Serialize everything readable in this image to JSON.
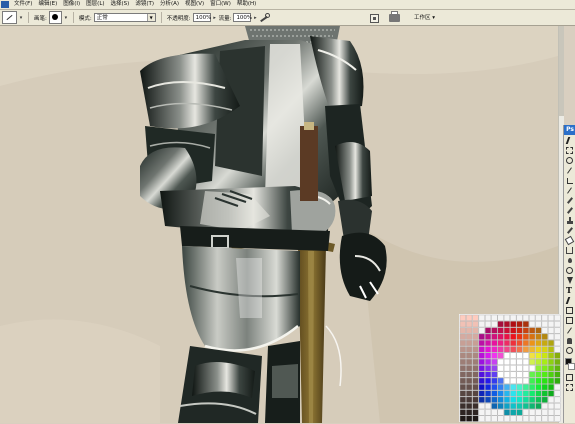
{
  "menubar": {
    "items": [
      "文件(F)",
      "编辑(E)",
      "图像(I)",
      "图层(L)",
      "选择(S)",
      "滤镜(T)",
      "分析(A)",
      "视图(V)",
      "窗口(W)",
      "帮助(H)"
    ]
  },
  "options": {
    "brush_label": "画笔:",
    "mode_label": "模式:",
    "mode_value": "正常",
    "opacity_label": "不透明度:",
    "opacity_value": "100%",
    "flow_label": "流量:",
    "flow_value": "100%",
    "workspace_label": "工作区"
  },
  "toolbox": {
    "logo": "Ps",
    "text_tool_glyph": "T",
    "tools": [
      "move-tool-icon",
      "marquee-tool-icon",
      "lasso-tool-icon",
      "magic-wand-tool-icon",
      "crop-tool-icon",
      "slice-tool-icon",
      "healing-brush-icon",
      "brush-tool-icon",
      "clone-stamp-icon",
      "history-brush-icon",
      "eraser-tool-icon",
      "gradient-tool-icon",
      "blur-tool-icon",
      "dodge-tool-icon",
      "pen-tool-icon",
      "text-tool-icon",
      "path-select-icon",
      "shape-tool-icon",
      "notes-tool-icon",
      "eyedropper-icon",
      "hand-tool-icon",
      "zoom-tool-icon"
    ]
  },
  "colors": {
    "foreground": "#111111",
    "background": "#ffffff",
    "accent": "#2a6fc9"
  }
}
